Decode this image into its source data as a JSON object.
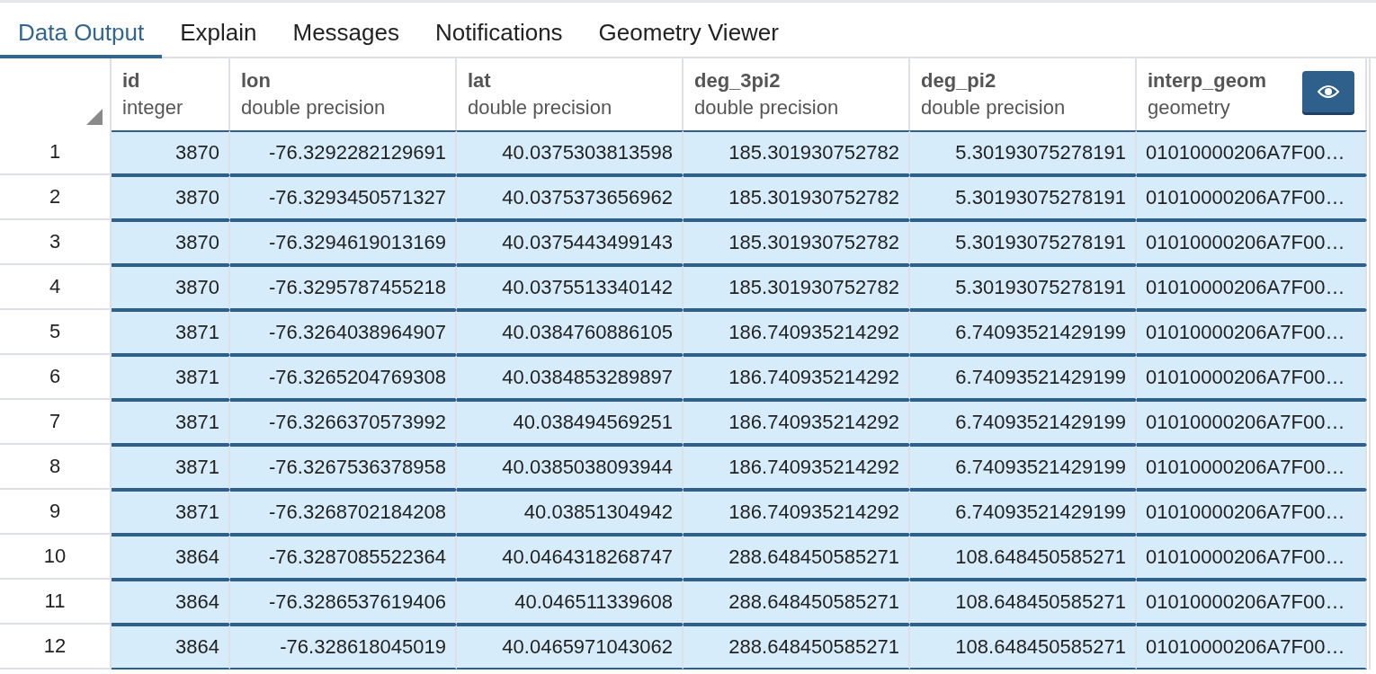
{
  "tabs": [
    {
      "label": "Data Output",
      "selected": true
    },
    {
      "label": "Explain",
      "selected": false
    },
    {
      "label": "Messages",
      "selected": false
    },
    {
      "label": "Notifications",
      "selected": false
    },
    {
      "label": "Geometry Viewer",
      "selected": false
    }
  ],
  "table": {
    "columns": [
      {
        "name": "id",
        "type": "integer",
        "kind": "plain"
      },
      {
        "name": "lon",
        "type": "double precision",
        "kind": "plain"
      },
      {
        "name": "lat",
        "type": "double precision",
        "kind": "plain"
      },
      {
        "name": "deg_3pi2",
        "type": "double precision",
        "kind": "plain"
      },
      {
        "name": "deg_pi2",
        "type": "double precision",
        "kind": "plain"
      },
      {
        "name": "interp_geom",
        "type": "geometry",
        "kind": "geometry"
      }
    ],
    "rows": [
      {
        "number": "1",
        "selected": true,
        "cells": [
          "3870",
          "-76.3292282129691",
          "40.0375303813598",
          "185.301930752782",
          "5.30193075278191",
          "01010000206A7F00…"
        ]
      },
      {
        "number": "2",
        "selected": true,
        "cells": [
          "3870",
          "-76.3293450571327",
          "40.0375373656962",
          "185.301930752782",
          "5.30193075278191",
          "01010000206A7F00…"
        ]
      },
      {
        "number": "3",
        "selected": true,
        "cells": [
          "3870",
          "-76.3294619013169",
          "40.0375443499143",
          "185.301930752782",
          "5.30193075278191",
          "01010000206A7F00…"
        ]
      },
      {
        "number": "4",
        "selected": true,
        "cells": [
          "3870",
          "-76.3295787455218",
          "40.0375513340142",
          "185.301930752782",
          "5.30193075278191",
          "01010000206A7F00…"
        ]
      },
      {
        "number": "5",
        "selected": true,
        "cells": [
          "3871",
          "-76.3264038964907",
          "40.0384760886105",
          "186.740935214292",
          "6.74093521429199",
          "01010000206A7F00…"
        ]
      },
      {
        "number": "6",
        "selected": true,
        "cells": [
          "3871",
          "-76.3265204769308",
          "40.0384853289897",
          "186.740935214292",
          "6.74093521429199",
          "01010000206A7F00…"
        ]
      },
      {
        "number": "7",
        "selected": true,
        "cells": [
          "3871",
          "-76.3266370573992",
          "40.038494569251",
          "186.740935214292",
          "6.74093521429199",
          "01010000206A7F00…"
        ]
      },
      {
        "number": "8",
        "selected": true,
        "cells": [
          "3871",
          "-76.3267536378958",
          "40.0385038093944",
          "186.740935214292",
          "6.74093521429199",
          "01010000206A7F00…"
        ]
      },
      {
        "number": "9",
        "selected": true,
        "cells": [
          "3871",
          "-76.3268702184208",
          "40.03851304942",
          "186.740935214292",
          "6.74093521429199",
          "01010000206A7F00…"
        ]
      },
      {
        "number": "10",
        "selected": true,
        "cells": [
          "3864",
          "-76.3287085522364",
          "40.0464318268747",
          "288.648450585271",
          "108.648450585271",
          "01010000206A7F00…"
        ]
      },
      {
        "number": "11",
        "selected": true,
        "cells": [
          "3864",
          "-76.3286537619406",
          "40.046511339608",
          "288.648450585271",
          "108.648450585271",
          "01010000206A7F00…"
        ]
      },
      {
        "number": "12",
        "selected": true,
        "cells": [
          "3864",
          "-76.328618045019",
          "40.0465971043062",
          "288.648450585271",
          "108.648450585271",
          "01010000206A7F00…"
        ]
      }
    ]
  }
}
